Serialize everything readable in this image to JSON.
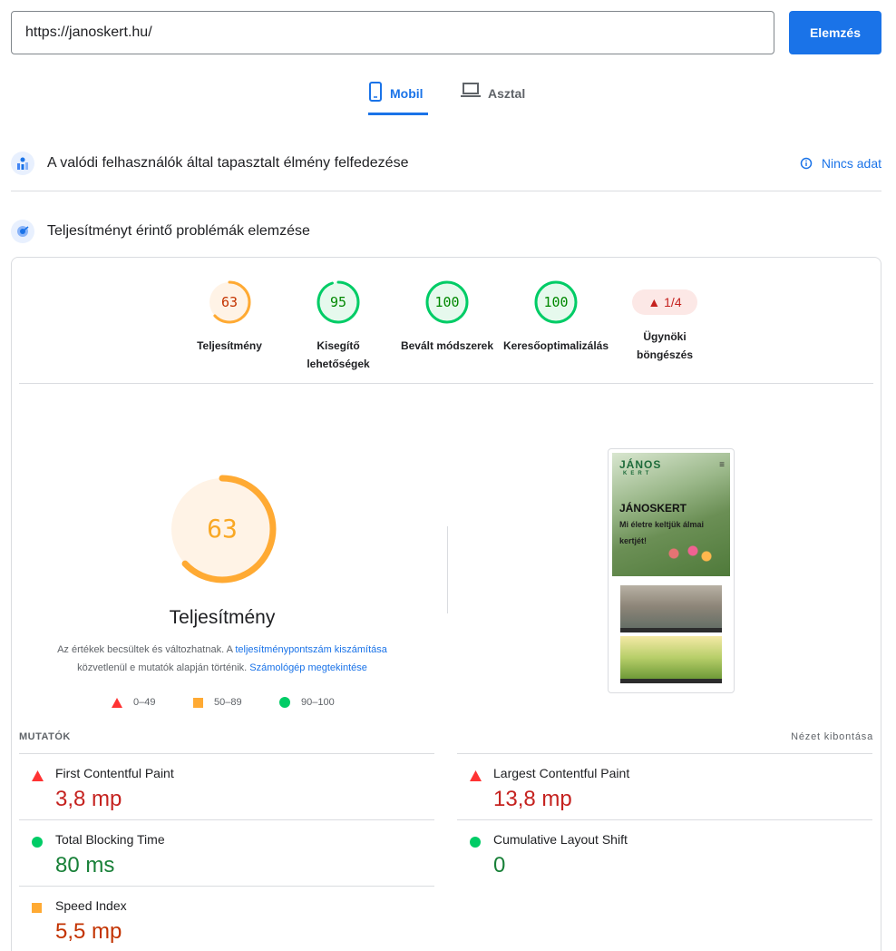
{
  "search": {
    "url": "https://janoskert.hu/",
    "button": "Elemzés"
  },
  "tabs": [
    {
      "label": "Mobil",
      "active": true,
      "icon": "phone-icon"
    },
    {
      "label": "Asztal",
      "active": false,
      "icon": "laptop-icon"
    }
  ],
  "crux": {
    "title": "A valódi felhasználók által tapasztalt élmény felfedezése",
    "status": "Nincs adat"
  },
  "lighthouse": {
    "title": "Teljesítményt érintő problémák elemzése"
  },
  "scores": [
    {
      "label": "Teljesítmény",
      "value": "63",
      "fraction": 0.63,
      "color": "#fa3"
    },
    {
      "label": "Kisegítő lehetőségek",
      "value": "95",
      "fraction": 0.95,
      "color": "#0c6"
    },
    {
      "label": "Bevált módszerek",
      "value": "100",
      "fraction": 1.0,
      "color": "#0c6"
    },
    {
      "label": "Keresőoptimalizálás",
      "value": "100",
      "fraction": 1.0,
      "color": "#0c6"
    }
  ],
  "agent": {
    "badge": "▲ 1/4",
    "label": "Ügynöki böngészés"
  },
  "perf": {
    "score": "63",
    "fraction": 0.63,
    "title": "Teljesítmény",
    "desc_pre": "Az értékek becsültek és változhatnak. A ",
    "desc_link1": "teljesítménypontszám kiszámítása",
    "desc_mid": " közvetlenül e mutatók alapján történik. ",
    "desc_link2": "Számológép megtekintése"
  },
  "legend": [
    {
      "range": "0–49",
      "shape": "triangle",
      "color": "#f33"
    },
    {
      "range": "50–89",
      "shape": "square",
      "color": "#fa3"
    },
    {
      "range": "90–100",
      "shape": "circle",
      "color": "#0c6"
    }
  ],
  "preview": {
    "logo": "JÁNOS",
    "logo_sub": "KERT",
    "headline": "JÁNOSKERT",
    "subline": "Mi életre keltjük álmai kertjét!"
  },
  "metrics_header": {
    "title": "MUTATÓK",
    "expand": "Nézet kibontása"
  },
  "metrics": [
    {
      "name": "First Contentful Paint",
      "value": "3,8 mp",
      "status": "fail"
    },
    {
      "name": "Largest Contentful Paint",
      "value": "13,8 mp",
      "status": "fail"
    },
    {
      "name": "Total Blocking Time",
      "value": "80 ms",
      "status": "pass"
    },
    {
      "name": "Cumulative Layout Shift",
      "value": "0",
      "status": "pass"
    },
    {
      "name": "Speed Index",
      "value": "5,5 mp",
      "status": "average"
    }
  ],
  "colors": {
    "accent": "#1a73e8",
    "pass": "#0c6",
    "average": "#fa3",
    "fail": "#f33"
  }
}
